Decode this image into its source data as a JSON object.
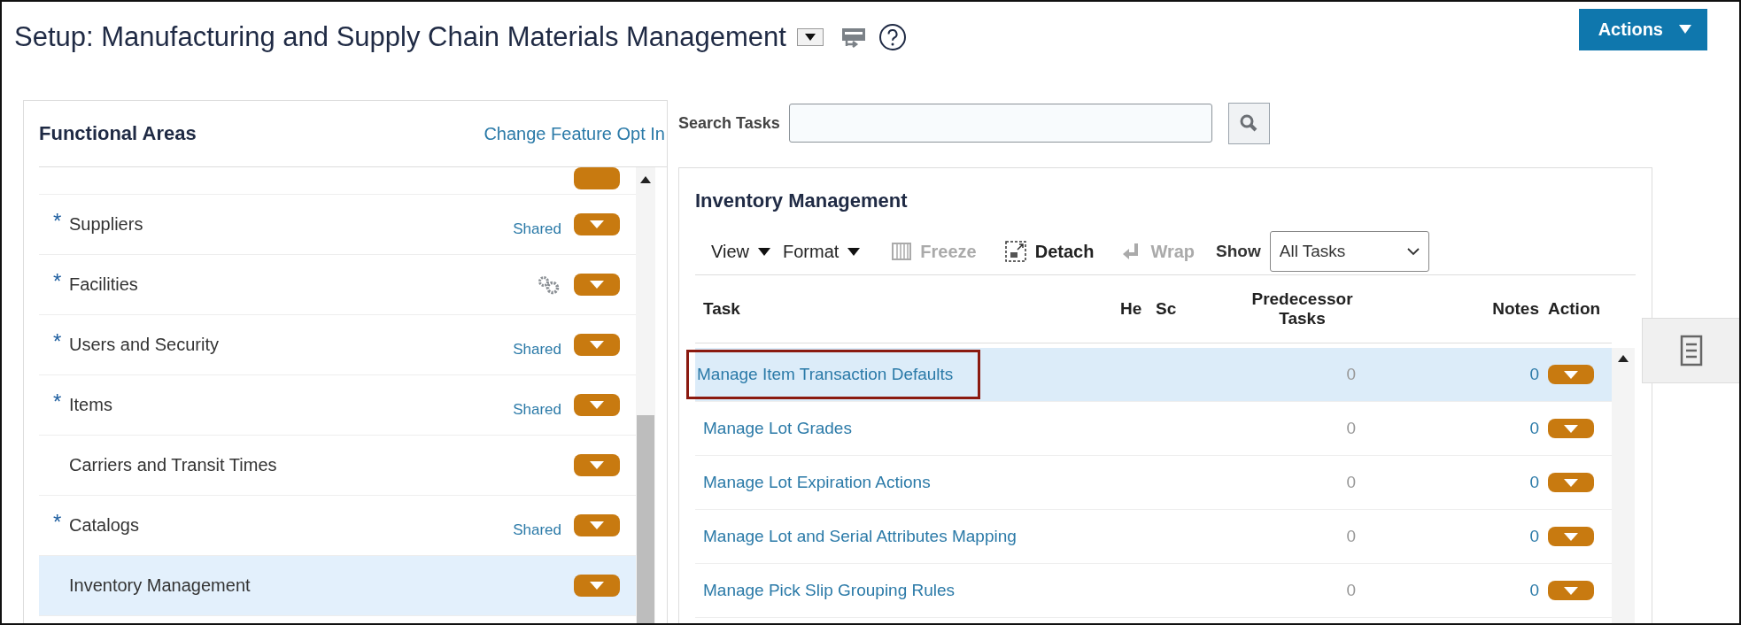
{
  "page": {
    "title": "Setup: Manufacturing and Supply Chain Materials Management",
    "actions_button": "Actions"
  },
  "functional_areas": {
    "title": "Functional Areas",
    "link": "Change Feature Opt In",
    "items": [
      {
        "label": "Suppliers",
        "marker": "*",
        "kind": "shared",
        "badge": "Shared",
        "selected": false
      },
      {
        "label": "Facilities",
        "marker": "*",
        "kind": "setup",
        "selected": false
      },
      {
        "label": "Users and Security",
        "marker": "*",
        "kind": "shared",
        "badge": "Shared",
        "selected": false
      },
      {
        "label": "Items",
        "marker": "*",
        "kind": "shared",
        "badge": "Shared",
        "selected": false
      },
      {
        "label": "Carriers and Transit Times",
        "kind": "plain",
        "selected": false
      },
      {
        "label": "Catalogs",
        "marker": "*",
        "kind": "shared",
        "badge": "Shared",
        "selected": false
      },
      {
        "label": "Inventory Management",
        "kind": "plain",
        "selected": true
      }
    ]
  },
  "search": {
    "label": "Search Tasks"
  },
  "tasks_panel": {
    "title": "Inventory Management",
    "toolbar": [
      {
        "label": "View",
        "kind": "menu",
        "disabled": false
      },
      {
        "label": "Format",
        "kind": "menu",
        "disabled": false
      },
      {
        "label": "Freeze",
        "kind": "freeze",
        "disabled": true
      },
      {
        "label": "Detach",
        "kind": "detach",
        "disabled": false
      },
      {
        "label": "Wrap",
        "kind": "wrap",
        "disabled": true
      }
    ],
    "show": {
      "label": "Show",
      "value": "All Tasks"
    },
    "columns": [
      "Task",
      "He",
      "Sc",
      "Predecessor Tasks",
      "Notes",
      "Action"
    ],
    "rows": [
      {
        "task": "Manage Item Transaction Defaults",
        "predecessors": "0",
        "notes": "0",
        "selected": true,
        "highlighted": true
      },
      {
        "task": "Manage Lot Grades",
        "predecessors": "0",
        "notes": "0",
        "selected": false,
        "highlighted": false
      },
      {
        "task": "Manage Lot Expiration Actions",
        "predecessors": "0",
        "notes": "0",
        "selected": false,
        "highlighted": false
      },
      {
        "task": "Manage Lot and Serial Attributes Mapping",
        "predecessors": "0",
        "notes": "0",
        "selected": false,
        "highlighted": false
      },
      {
        "task": "Manage Pick Slip Grouping Rules",
        "predecessors": "0",
        "notes": "0",
        "selected": false,
        "highlighted": false
      }
    ]
  }
}
